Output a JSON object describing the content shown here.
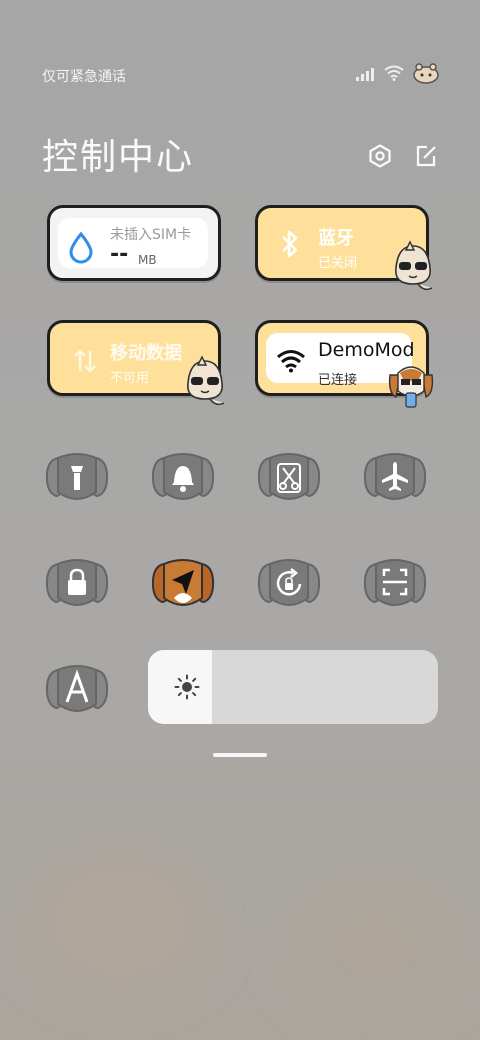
{
  "status": {
    "carrier": "仅可紧急通话"
  },
  "title": "控制中心",
  "cards": {
    "sim": {
      "label": "未插入SIM卡",
      "value": "--",
      "unit": "MB"
    },
    "bluetooth": {
      "label": "蓝牙",
      "status": "已关闭"
    },
    "mobile_data": {
      "label": "移动数据",
      "status": "不可用"
    },
    "wifi": {
      "label": "DemoMod",
      "status": "已连接"
    }
  },
  "tiles": [
    {
      "name": "flashlight",
      "active": false
    },
    {
      "name": "bell",
      "active": false
    },
    {
      "name": "screenshot",
      "active": false
    },
    {
      "name": "airplane-mode",
      "active": false
    },
    {
      "name": "lock-screen",
      "active": false
    },
    {
      "name": "location",
      "active": true
    },
    {
      "name": "auto-rotate",
      "active": false
    },
    {
      "name": "scanner",
      "active": false
    },
    {
      "name": "auto-brightness",
      "active": false
    }
  ],
  "brightness": {
    "level": 0.22
  },
  "colors": {
    "accent_yellow": "#ffe09a",
    "dog_brown": "#c97a34",
    "tile_gray": "#7a7a7a"
  }
}
